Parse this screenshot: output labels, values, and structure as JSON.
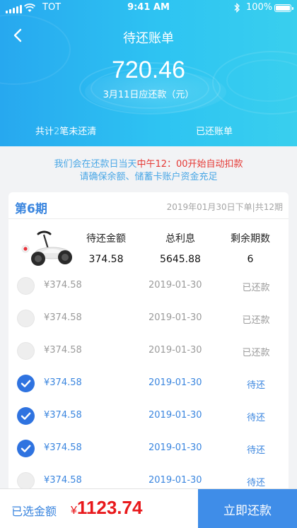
{
  "status_bar": {
    "carrier": "TOT",
    "time": "9:41 AM",
    "battery": "100%"
  },
  "nav": {
    "title": "待还账单"
  },
  "header": {
    "amount": "720.46",
    "due_text": "3月11日应还款（元）",
    "unpaid_prefix": "共计",
    "unpaid_count": "2",
    "unpaid_suffix": "笔未还清",
    "paid_link": "已还账单"
  },
  "notice": {
    "line1_start": "我们会在还款日当天",
    "line1_highlight": "中午12：00开始自动扣款",
    "line2": "请确保余额、储蓄卡账户资金充足"
  },
  "card": {
    "period": "第6期",
    "order_info": "2019年01月30日下单|共12期",
    "summary": {
      "labels": [
        "待还金额",
        "总利息",
        "剩余期数"
      ],
      "values": [
        "374.58",
        "5645.88",
        "6"
      ]
    },
    "rows": [
      {
        "amount": "¥374.58",
        "date": "2019-01-30",
        "status": "已还款",
        "checked": false
      },
      {
        "amount": "¥374.58",
        "date": "2019-01-30",
        "status": "已还款",
        "checked": false
      },
      {
        "amount": "¥374.58",
        "date": "2019-01-30",
        "status": "已还款",
        "checked": false
      },
      {
        "amount": "¥374.58",
        "date": "2019-01-30",
        "status": "待还",
        "checked": true
      },
      {
        "amount": "¥374.58",
        "date": "2019-01-30",
        "status": "待还",
        "checked": true
      },
      {
        "amount": "¥374.58",
        "date": "2019-01-30",
        "status": "待还",
        "checked": true
      },
      {
        "amount": "¥374.58",
        "date": "2019-01-30",
        "status": "待还",
        "checked": false
      }
    ]
  },
  "bottom": {
    "selected_label": "已选金额",
    "currency": "¥",
    "selected_amount": "1123.74",
    "pay_button": "立即还款"
  },
  "colors": {
    "accent": "#3b86df",
    "header_gradient_start": "#27a8ef",
    "header_gradient_end": "#39cfee",
    "price_red": "#e8191c",
    "pay_button": "#3f8de8"
  }
}
